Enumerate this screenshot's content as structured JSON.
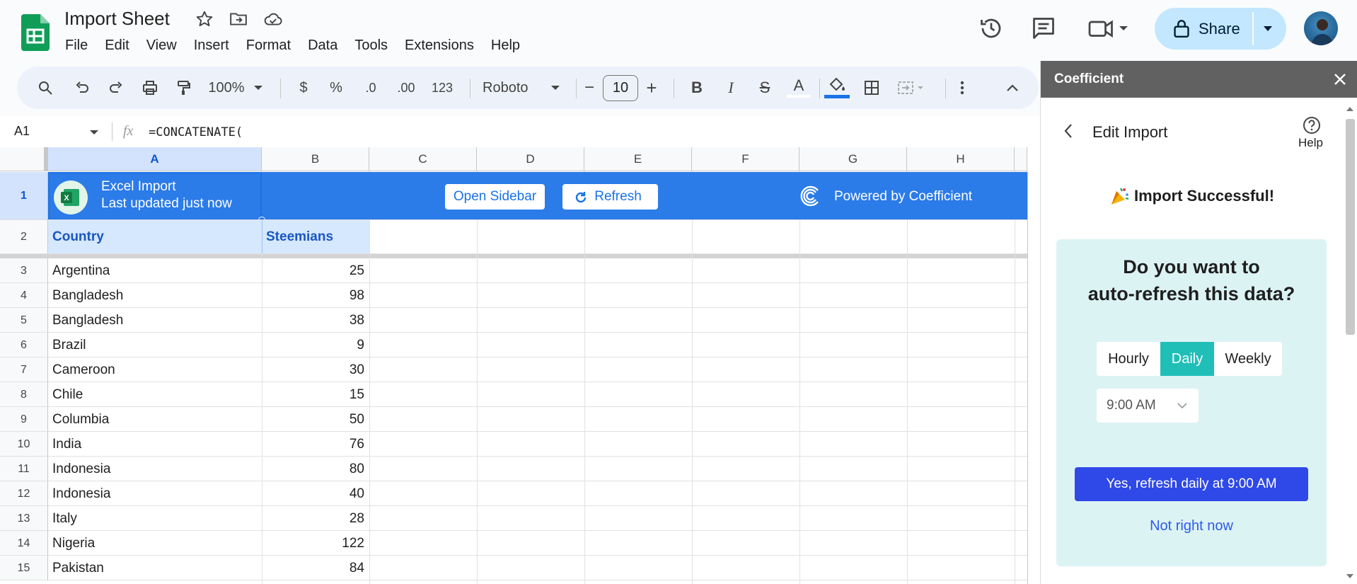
{
  "doc": {
    "title": "Import Sheet",
    "menu": [
      "File",
      "Edit",
      "View",
      "Insert",
      "Format",
      "Data",
      "Tools",
      "Extensions",
      "Help"
    ]
  },
  "header": {
    "share_label": "Share"
  },
  "toolbar": {
    "zoom": "100%",
    "currency": "$",
    "percent": "%",
    "dec_decrease": ".0",
    "dec_increase": ".00",
    "number_format": "123",
    "font": "Roboto",
    "font_size": "10",
    "minus": "−",
    "plus": "+",
    "bold": "B",
    "italic": "I",
    "strike": "S",
    "text_color": "A"
  },
  "formula_bar": {
    "cell_ref": "A1",
    "fx": "fx",
    "formula": "=CONCATENATE("
  },
  "grid": {
    "columns": [
      "A",
      "B",
      "C",
      "D",
      "E",
      "F",
      "G",
      "H"
    ],
    "banner": {
      "title": "Excel Import",
      "subtitle": "Last updated just now",
      "open_sidebar": "Open Sidebar",
      "refresh": "Refresh",
      "powered_by": "Powered by Coefficient"
    },
    "header_row": {
      "row": "2",
      "a": "Country",
      "b": "Steemians"
    },
    "rows": [
      {
        "n": "3",
        "country": "Argentina",
        "value": "25"
      },
      {
        "n": "4",
        "country": "Bangladesh",
        "value": "98"
      },
      {
        "n": "5",
        "country": "Bangladesh",
        "value": "38"
      },
      {
        "n": "6",
        "country": "Brazil",
        "value": "9"
      },
      {
        "n": "7",
        "country": "Cameroon",
        "value": "30"
      },
      {
        "n": "8",
        "country": "Chile",
        "value": "15"
      },
      {
        "n": "9",
        "country": "Columbia",
        "value": "50"
      },
      {
        "n": "10",
        "country": "India",
        "value": "76"
      },
      {
        "n": "11",
        "country": "Indonesia",
        "value": "80"
      },
      {
        "n": "12",
        "country": "Indonesia",
        "value": "40"
      },
      {
        "n": "13",
        "country": "Italy",
        "value": "28"
      },
      {
        "n": "14",
        "country": "Nigeria",
        "value": "122"
      },
      {
        "n": "15",
        "country": "Pakistan",
        "value": "84"
      }
    ],
    "row1_label": "1"
  },
  "panel": {
    "app_name": "Coefficient",
    "heading": "Edit Import",
    "help": "Help",
    "success": "Import Successful!",
    "question_line1": "Do you want to",
    "question_line2": "auto-refresh this data?",
    "options": [
      "Hourly",
      "Daily",
      "Weekly"
    ],
    "selected_option": "Daily",
    "time": "9:00 AM",
    "confirm": "Yes, refresh daily at 9:00 AM",
    "decline": "Not right now"
  },
  "colors": {
    "banner_blue": "#2b7be9",
    "teal_selected": "#1fbfb8",
    "cta_blue": "#2f48e8",
    "share_bg": "#c2e7ff"
  }
}
